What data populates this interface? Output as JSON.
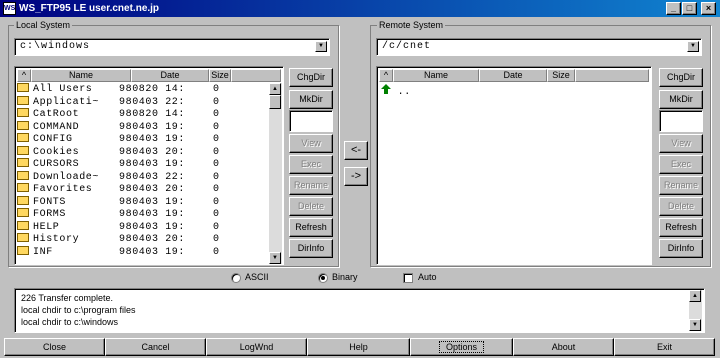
{
  "window": {
    "title": "WS_FTP95 LE user.cnet.ne.jp",
    "icon_label": "WS"
  },
  "window_controls": {
    "minimize": "_",
    "maximize": "□",
    "close": "×"
  },
  "local": {
    "group_title": "Local System",
    "path": "c:\\windows",
    "headers": {
      "name": "Name",
      "date": "Date",
      "size": "Size"
    },
    "files": [
      {
        "name": "All Users",
        "date": "980820 14:",
        "size": "0"
      },
      {
        "name": "Applicati~",
        "date": "980403 22:",
        "size": "0"
      },
      {
        "name": "CatRoot",
        "date": "980820 14:",
        "size": "0"
      },
      {
        "name": "COMMAND",
        "date": "980403 19:",
        "size": "0"
      },
      {
        "name": "CONFIG",
        "date": "980403 19:",
        "size": "0"
      },
      {
        "name": "Cookies",
        "date": "980403 20:",
        "size": "0"
      },
      {
        "name": "CURSORS",
        "date": "980403 19:",
        "size": "0"
      },
      {
        "name": "Downloade~",
        "date": "980403 22:",
        "size": "0"
      },
      {
        "name": "Favorites",
        "date": "980403 20:",
        "size": "0"
      },
      {
        "name": "FONTS",
        "date": "980403 19:",
        "size": "0"
      },
      {
        "name": "FORMS",
        "date": "980403 19:",
        "size": "0"
      },
      {
        "name": "HELP",
        "date": "980403 19:",
        "size": "0"
      },
      {
        "name": "History",
        "date": "980403 20:",
        "size": "0"
      },
      {
        "name": "INF",
        "date": "980403 19:",
        "size": "0"
      }
    ]
  },
  "remote": {
    "group_title": "Remote System",
    "path": "/c/cnet",
    "headers": {
      "name": "Name",
      "date": "Date",
      "size": "Size"
    },
    "files": [
      {
        "name": ".."
      }
    ]
  },
  "side_buttons": {
    "chgdir": "ChgDir",
    "mkdir": "MkDir",
    "view": "View",
    "exec": "Exec",
    "rename": "Rename",
    "delete": "Delete",
    "refresh": "Refresh",
    "dirinfo": "DirInfo"
  },
  "transfer": {
    "to_local": "<-",
    "to_remote": "->"
  },
  "mode": {
    "ascii": "ASCII",
    "binary": "Binary",
    "auto": "Auto",
    "selected": "Binary",
    "auto_checked": false
  },
  "log": [
    "226 Transfer complete.",
    "local chdir to c:\\program files",
    "local chdir to c:\\windows"
  ],
  "bottom_buttons": [
    "Close",
    "Cancel",
    "LogWnd",
    "Help",
    "Options",
    "About",
    "Exit"
  ],
  "colors": {
    "title_start": "#000080",
    "title_end": "#1084d0",
    "folder": "#ffd860",
    "up_arrow": "#008000"
  }
}
